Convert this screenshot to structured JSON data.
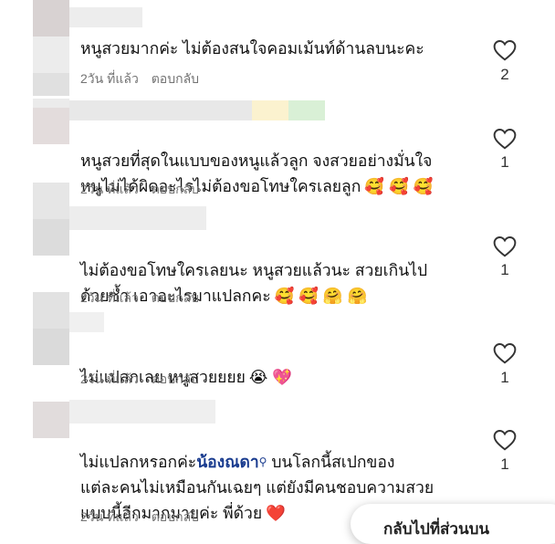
{
  "comments": [
    {
      "text": "หนูสวยมากค่ะ ไม่ต้องสนใจคอมเม้นท์ด้านลบนะคะ",
      "time": "2วัน ที่แล้ว",
      "reply_label": "ตอบกลับ",
      "likes": "2"
    },
    {
      "text": "หนูสวยที่สุดในแบบของหนูแล้วลูก จงสวยอย่างมั่นใจ\nหนูไม่ได้ผิดอะไรไม่ต้องขอโทษใครเลยลูก",
      "emoji": "🥰 🥰 🥰",
      "time": "2วัน ที่แล้ว",
      "reply_label": "ตอบกลับ",
      "likes": "1"
    },
    {
      "text": "ไม่ต้องขอโทษใครเลยนะ หนูสวยแล้วนะ สวยเกินไป\nด้วยซ้ำ เอาอะไรมาแปลกคะ",
      "emoji": "🥰 🥰 🤗 🤗",
      "time": "2วัน ที่แล้ว",
      "reply_label": "ตอบกลับ",
      "likes": "1"
    },
    {
      "text": "ไม่แปลกเลย หนูสวยยยย",
      "emoji": "😭 💖",
      "time": "2วัน ที่แล้ว",
      "reply_label": "ตอบกลับ",
      "likes": "1"
    },
    {
      "text_before": "ไม่แปลกหรอกค่ะ",
      "mention": "น้องณดา",
      "text_after": " บนโลกนี้สเปกของ\nแต่ละคนไม่เหมือนกันเฉยๆ แต่ยังมีคนชอบความสวย\nแบบนี้อีกมากมายค่ะ พี่ด้วย",
      "emoji": "❤️",
      "time": "2วัน ที่แล้ว",
      "reply_label": "ตอบกลับ",
      "likes": "1"
    }
  ],
  "back_button_label": "กลับไปที่ส่วนบน",
  "colors": {
    "meta": "#737373",
    "mention": "#1a3c8f",
    "heart_stroke": "#333333"
  }
}
